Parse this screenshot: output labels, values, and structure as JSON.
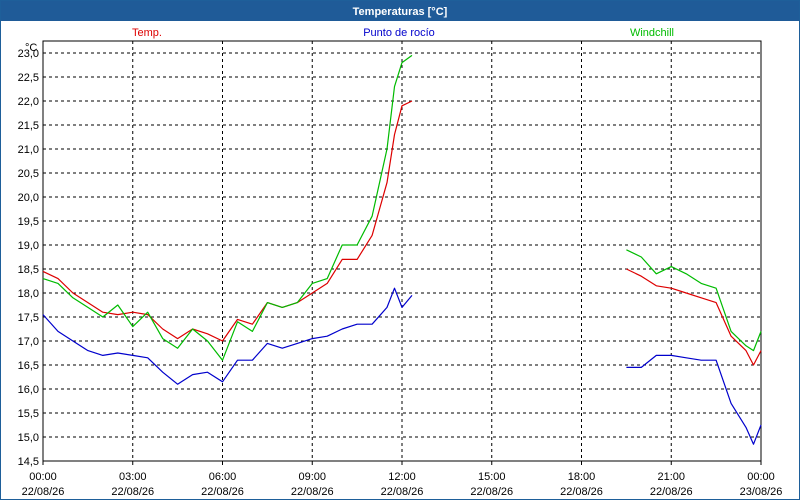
{
  "window": {
    "title": "Temperaturas [°C]"
  },
  "colors": {
    "title_bg": "#1f5b98",
    "temp": "#dd0000",
    "dew": "#0000cc",
    "wind": "#00bb00"
  },
  "chart_data": {
    "type": "line",
    "title": "Temperaturas [°C]",
    "ylabel": "°C",
    "ylim": [
      14.5,
      23.25
    ],
    "ytick_labels": [
      "14,5",
      "15,0",
      "15,5",
      "16,0",
      "16,5",
      "17,0",
      "17,5",
      "18,0",
      "18,5",
      "19,0",
      "19,5",
      "20,0",
      "20,5",
      "21,0",
      "21,5",
      "22,0",
      "22,5",
      "23,0"
    ],
    "xlim": [
      "22/08/26 00:00",
      "23/08/26 00:00"
    ],
    "xtick_labels": [
      {
        "time": "00:00",
        "date": "22/08/26"
      },
      {
        "time": "03:00",
        "date": "22/08/26"
      },
      {
        "time": "06:00",
        "date": "22/08/26"
      },
      {
        "time": "09:00",
        "date": "22/08/26"
      },
      {
        "time": "12:00",
        "date": "22/08/26"
      },
      {
        "time": "15:00",
        "date": "22/08/26"
      },
      {
        "time": "18:00",
        "date": "22/08/26"
      },
      {
        "time": "21:00",
        "date": "22/08/26"
      },
      {
        "time": "00:00",
        "date": "23/08/26"
      }
    ],
    "grid": true,
    "series": [
      {
        "name": "Temp.",
        "color": "#dd0000",
        "segments": [
          [
            [
              "00:00",
              18.45
            ],
            [
              "00:30",
              18.3
            ],
            [
              "01:00",
              18.0
            ],
            [
              "01:30",
              17.8
            ],
            [
              "02:00",
              17.6
            ],
            [
              "02:30",
              17.55
            ],
            [
              "03:00",
              17.6
            ],
            [
              "03:30",
              17.55
            ],
            [
              "04:00",
              17.25
            ],
            [
              "04:30",
              17.05
            ],
            [
              "05:00",
              17.25
            ],
            [
              "05:30",
              17.15
            ],
            [
              "06:00",
              17.0
            ],
            [
              "06:30",
              17.45
            ],
            [
              "07:00",
              17.35
            ],
            [
              "07:30",
              17.8
            ],
            [
              "08:00",
              17.7
            ],
            [
              "08:30",
              17.8
            ],
            [
              "09:00",
              18.0
            ],
            [
              "09:30",
              18.2
            ],
            [
              "10:00",
              18.7
            ],
            [
              "10:30",
              18.7
            ],
            [
              "11:00",
              19.2
            ],
            [
              "11:30",
              20.3
            ],
            [
              "11:45",
              21.3
            ],
            [
              "12:00",
              21.9
            ],
            [
              "12:20",
              22.0
            ]
          ],
          [
            [
              "19:30",
              18.5
            ],
            [
              "20:00",
              18.35
            ],
            [
              "20:30",
              18.15
            ],
            [
              "21:00",
              18.1
            ],
            [
              "21:30",
              18.0
            ],
            [
              "22:00",
              17.9
            ],
            [
              "22:30",
              17.8
            ],
            [
              "23:00",
              17.1
            ],
            [
              "23:30",
              16.8
            ],
            [
              "23:45",
              16.5
            ],
            [
              "24:00",
              16.8
            ]
          ]
        ]
      },
      {
        "name": "Punto de rocío",
        "color": "#0000cc",
        "segments": [
          [
            [
              "00:00",
              17.55
            ],
            [
              "00:30",
              17.2
            ],
            [
              "01:00",
              17.0
            ],
            [
              "01:30",
              16.8
            ],
            [
              "02:00",
              16.7
            ],
            [
              "02:30",
              16.75
            ],
            [
              "03:00",
              16.7
            ],
            [
              "03:30",
              16.65
            ],
            [
              "04:00",
              16.35
            ],
            [
              "04:30",
              16.1
            ],
            [
              "05:00",
              16.3
            ],
            [
              "05:30",
              16.35
            ],
            [
              "06:00",
              16.15
            ],
            [
              "06:30",
              16.6
            ],
            [
              "07:00",
              16.6
            ],
            [
              "07:30",
              16.95
            ],
            [
              "08:00",
              16.85
            ],
            [
              "08:30",
              16.95
            ],
            [
              "09:00",
              17.05
            ],
            [
              "09:30",
              17.1
            ],
            [
              "10:00",
              17.25
            ],
            [
              "10:30",
              17.35
            ],
            [
              "11:00",
              17.35
            ],
            [
              "11:30",
              17.7
            ],
            [
              "11:45",
              18.1
            ],
            [
              "12:00",
              17.7
            ],
            [
              "12:20",
              17.95
            ]
          ],
          [
            [
              "19:30",
              16.45
            ],
            [
              "20:00",
              16.45
            ],
            [
              "20:30",
              16.7
            ],
            [
              "21:00",
              16.7
            ],
            [
              "21:30",
              16.65
            ],
            [
              "22:00",
              16.6
            ],
            [
              "22:30",
              16.6
            ],
            [
              "23:00",
              15.7
            ],
            [
              "23:30",
              15.2
            ],
            [
              "23:45",
              14.85
            ],
            [
              "24:00",
              15.25
            ]
          ]
        ]
      },
      {
        "name": "Windchill",
        "color": "#00bb00",
        "segments": [
          [
            [
              "00:00",
              18.3
            ],
            [
              "00:30",
              18.2
            ],
            [
              "01:00",
              17.9
            ],
            [
              "01:30",
              17.7
            ],
            [
              "02:00",
              17.5
            ],
            [
              "02:30",
              17.75
            ],
            [
              "03:00",
              17.3
            ],
            [
              "03:30",
              17.6
            ],
            [
              "04:00",
              17.05
            ],
            [
              "04:30",
              16.85
            ],
            [
              "05:00",
              17.25
            ],
            [
              "05:30",
              17.0
            ],
            [
              "06:00",
              16.6
            ],
            [
              "06:30",
              17.4
            ],
            [
              "07:00",
              17.2
            ],
            [
              "07:30",
              17.8
            ],
            [
              "08:00",
              17.7
            ],
            [
              "08:30",
              17.8
            ],
            [
              "09:00",
              18.2
            ],
            [
              "09:30",
              18.3
            ],
            [
              "10:00",
              19.0
            ],
            [
              "10:30",
              19.0
            ],
            [
              "11:00",
              19.6
            ],
            [
              "11:30",
              21.0
            ],
            [
              "11:45",
              22.3
            ],
            [
              "12:00",
              22.8
            ],
            [
              "12:20",
              22.95
            ]
          ],
          [
            [
              "19:30",
              18.9
            ],
            [
              "20:00",
              18.75
            ],
            [
              "20:30",
              18.4
            ],
            [
              "21:00",
              18.55
            ],
            [
              "21:30",
              18.4
            ],
            [
              "22:00",
              18.2
            ],
            [
              "22:30",
              18.1
            ],
            [
              "23:00",
              17.2
            ],
            [
              "23:30",
              16.9
            ],
            [
              "23:45",
              16.8
            ],
            [
              "24:00",
              17.2
            ]
          ]
        ]
      }
    ]
  }
}
